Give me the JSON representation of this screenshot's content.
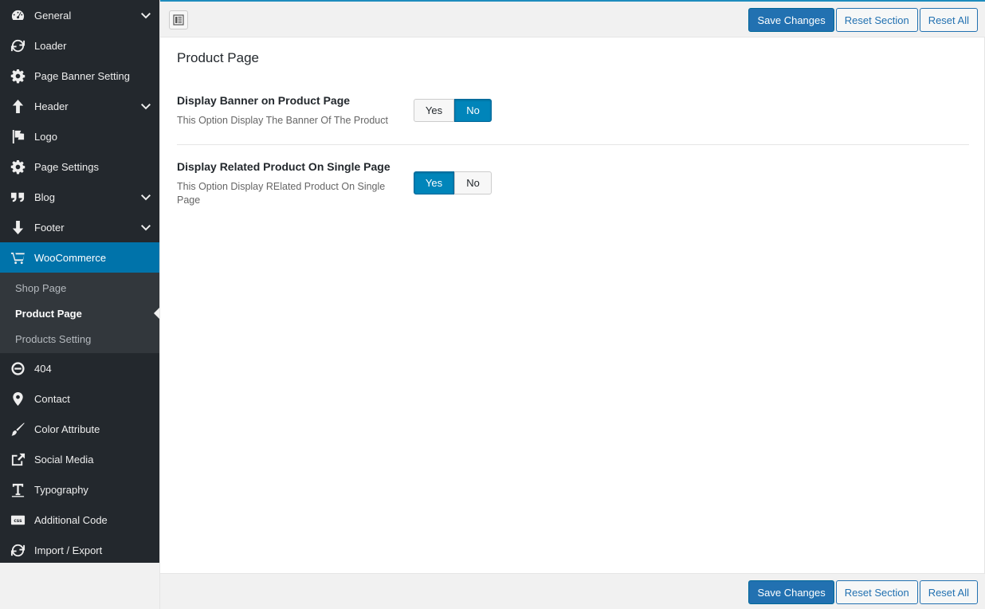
{
  "sidebar": {
    "items": [
      {
        "label": "General",
        "icon": "dashboard-icon",
        "has_submenu": true
      },
      {
        "label": "Loader",
        "icon": "refresh-icon",
        "has_submenu": false
      },
      {
        "label": "Page Banner Setting",
        "icon": "gear-icon",
        "has_submenu": false
      },
      {
        "label": "Header",
        "icon": "arrow-up-icon",
        "has_submenu": true
      },
      {
        "label": "Logo",
        "icon": "flag-icon",
        "has_submenu": false
      },
      {
        "label": "Page Settings",
        "icon": "gear-icon",
        "has_submenu": false
      },
      {
        "label": "Blog",
        "icon": "quote-icon",
        "has_submenu": true
      },
      {
        "label": "Footer",
        "icon": "arrow-down-icon",
        "has_submenu": true
      },
      {
        "label": "WooCommerce",
        "icon": "cart-icon",
        "active": true
      },
      {
        "label": "404",
        "icon": "minus-circle-icon"
      },
      {
        "label": "Contact",
        "icon": "location-pin-icon"
      },
      {
        "label": "Color Attribute",
        "icon": "brush-icon"
      },
      {
        "label": "Social Media",
        "icon": "share-icon"
      },
      {
        "label": "Typography",
        "icon": "text-icon"
      },
      {
        "label": "Additional Code",
        "icon": "css-icon"
      },
      {
        "label": "Import / Export",
        "icon": "refresh-icon"
      }
    ],
    "submenu": [
      {
        "label": "Shop Page"
      },
      {
        "label": "Product Page",
        "current": true
      },
      {
        "label": "Products Setting"
      }
    ]
  },
  "toolbar": {
    "save_label": "Save Changes",
    "reset_section_label": "Reset Section",
    "reset_all_label": "Reset All"
  },
  "section": {
    "title": "Product Page",
    "fields": [
      {
        "label": "Display Banner on Product Page",
        "description": "This Option Display The Banner Of The Product",
        "yes_label": "Yes",
        "no_label": "No",
        "value": "No"
      },
      {
        "label": "Display Related Product On Single Page",
        "description": "This Option Display RElated Product On Single Page",
        "yes_label": "Yes",
        "no_label": "No",
        "value": "Yes"
      }
    ]
  },
  "colors": {
    "sidebar_bg": "#23282d",
    "submenu_bg": "#32373c",
    "accent": "#0073aa",
    "primary_button": "#2271b1"
  }
}
